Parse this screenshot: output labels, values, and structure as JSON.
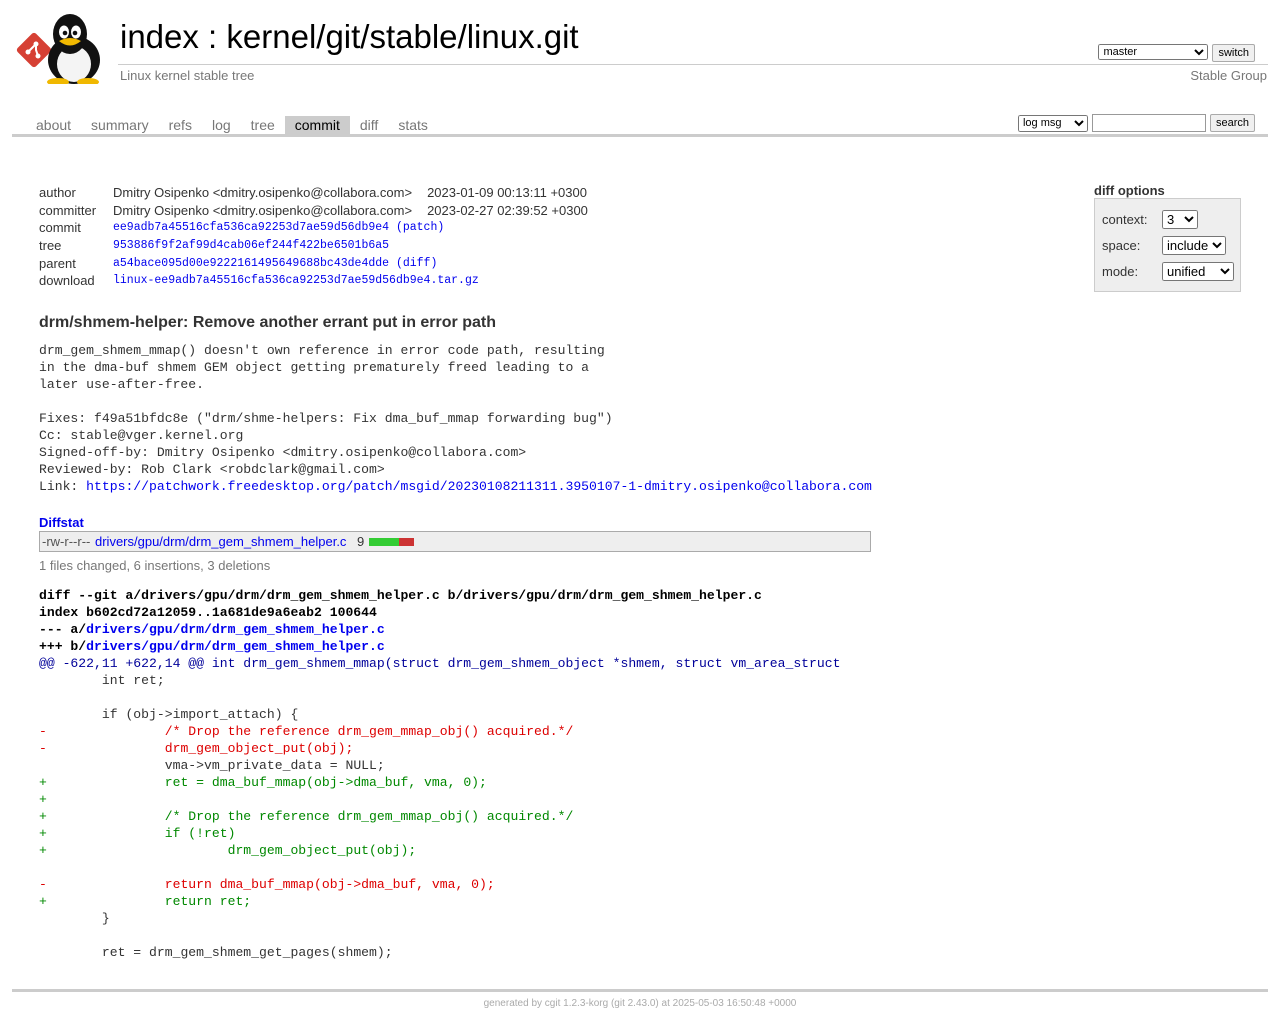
{
  "header": {
    "title_index": "index",
    "title_sep": " : ",
    "title_repo": "kernel/git/stable/linux.git",
    "subtitle": "Linux kernel stable tree",
    "owner": "Stable Group",
    "branch_value": "master",
    "switch_label": "switch"
  },
  "tabs": [
    {
      "label": "about"
    },
    {
      "label": "summary"
    },
    {
      "label": "refs"
    },
    {
      "label": "log"
    },
    {
      "label": "tree"
    },
    {
      "label": "commit",
      "active": true
    },
    {
      "label": "diff"
    },
    {
      "label": "stats"
    }
  ],
  "search": {
    "select_value": "log msg",
    "input_value": "",
    "button_label": "search"
  },
  "commit_info": {
    "author_label": "author",
    "author": "Dmitry Osipenko <dmitry.osipenko@collabora.com>",
    "author_date": "2023-01-09 00:13:11 +0300",
    "committer_label": "committer",
    "committer": "Dmitry Osipenko <dmitry.osipenko@collabora.com>",
    "committer_date": "2023-02-27 02:39:52 +0300",
    "commit_label": "commit",
    "commit": "ee9adb7a45516cfa536ca92253d7ae59d56db9e4",
    "patch_link": "(patch)",
    "tree_label": "tree",
    "tree": "953886f9f2af99d4cab06ef244f422be6501b6a5",
    "parent_label": "parent",
    "parent": "a54bace095d00e9222161495649688bc43de4dde",
    "diff_link": "(diff)",
    "download_label": "download",
    "download": "linux-ee9adb7a45516cfa536ca92253d7ae59d56db9e4.tar.gz"
  },
  "diff_options": {
    "title": "diff options",
    "context_label": "context:",
    "context_value": "3",
    "space_label": "space:",
    "space_value": "include",
    "mode_label": "mode:",
    "mode_value": "unified"
  },
  "commit": {
    "subject": "drm/shmem-helper: Remove another errant put in error path",
    "message": "drm_gem_shmem_mmap() doesn't own reference in error code path, resulting\nin the dma-buf shmem GEM object getting prematurely freed leading to a\nlater use-after-free.\n\nFixes: f49a51bfdc8e (\"drm/shme-helpers: Fix dma_buf_mmap forwarding bug\")\nCc: stable@vger.kernel.org\nSigned-off-by: Dmitry Osipenko <dmitry.osipenko@collabora.com>\nReviewed-by: Rob Clark <robdclark@gmail.com>\nLink: ",
    "link": "https://patchwork.freedesktop.org/patch/msgid/20230108211311.3950107-1-dmitry.osipenko@collabora.com"
  },
  "diffstat": {
    "header": "Diffstat",
    "mode": "-rw-r--r--",
    "file": "drivers/gpu/drm/drm_gem_shmem_helper.c",
    "count": "9",
    "insertions": 6,
    "deletions": 3,
    "summary": "1 files changed, 6 insertions, 3 deletions"
  },
  "diff": {
    "git_line": "diff --git a/drivers/gpu/drm/drm_gem_shmem_helper.c b/drivers/gpu/drm/drm_gem_shmem_helper.c",
    "index_line": "index b602cd72a12059..1a681de9a6eab2 100644",
    "minus_prefix": "--- a/",
    "plus_prefix": "+++ b/",
    "file": "drivers/gpu/drm/drm_gem_shmem_helper.c",
    "hunk": "@@ -622,11 +622,14 @@ int drm_gem_shmem_mmap(struct drm_gem_shmem_object *shmem, struct vm_area_struct",
    "lines": [
      {
        "t": "ctx",
        "s": " \tint ret;"
      },
      {
        "t": "ctx",
        "s": " "
      },
      {
        "t": "ctx",
        "s": " \tif (obj->import_attach) {"
      },
      {
        "t": "del",
        "s": "-\t\t/* Drop the reference drm_gem_mmap_obj() acquired.*/"
      },
      {
        "t": "del",
        "s": "-\t\tdrm_gem_object_put(obj);"
      },
      {
        "t": "ctx",
        "s": " \t\tvma->vm_private_data = NULL;"
      },
      {
        "t": "add",
        "s": "+\t\tret = dma_buf_mmap(obj->dma_buf, vma, 0);"
      },
      {
        "t": "add",
        "s": "+"
      },
      {
        "t": "add",
        "s": "+\t\t/* Drop the reference drm_gem_mmap_obj() acquired.*/"
      },
      {
        "t": "add",
        "s": "+\t\tif (!ret)"
      },
      {
        "t": "add",
        "s": "+\t\t\tdrm_gem_object_put(obj);"
      },
      {
        "t": "ctx",
        "s": " "
      },
      {
        "t": "del",
        "s": "-\t\treturn dma_buf_mmap(obj->dma_buf, vma, 0);"
      },
      {
        "t": "add",
        "s": "+\t\treturn ret;"
      },
      {
        "t": "ctx",
        "s": " \t}"
      },
      {
        "t": "ctx",
        "s": " "
      },
      {
        "t": "ctx",
        "s": " \tret = drm_gem_shmem_get_pages(shmem);"
      }
    ]
  },
  "footer": {
    "prefix": "generated by ",
    "cgit": "cgit 1.2.3-korg",
    "suffix": " (git 2.43.0) at 2025-05-03 16:50:48 +0000"
  },
  "colors": {
    "insertion": "#33cc33",
    "deletion": "#cc3333",
    "active_tab": "#cccccc"
  }
}
